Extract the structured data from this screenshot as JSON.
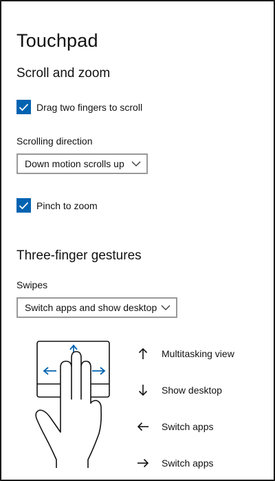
{
  "page": {
    "title": "Touchpad"
  },
  "scroll_zoom": {
    "heading": "Scroll and zoom",
    "drag_two_fingers": {
      "label": "Drag two fingers to scroll",
      "checked": true
    },
    "scrolling_direction": {
      "label": "Scrolling direction",
      "value": "Down motion scrolls up"
    },
    "pinch_to_zoom": {
      "label": "Pinch to zoom",
      "checked": true
    }
  },
  "three_finger": {
    "heading": "Three-finger gestures",
    "swipes": {
      "label": "Swipes",
      "value": "Switch apps and show desktop"
    },
    "gestures": [
      {
        "direction": "up",
        "icon": "arrow-up-icon",
        "label": "Multitasking view"
      },
      {
        "direction": "down",
        "icon": "arrow-down-icon",
        "label": "Show desktop"
      },
      {
        "direction": "left",
        "icon": "arrow-left-icon",
        "label": "Switch apps"
      },
      {
        "direction": "right",
        "icon": "arrow-right-icon",
        "label": "Switch apps"
      }
    ]
  },
  "colors": {
    "accent": "#0063b1",
    "text": "#111111",
    "border": "#999999"
  }
}
